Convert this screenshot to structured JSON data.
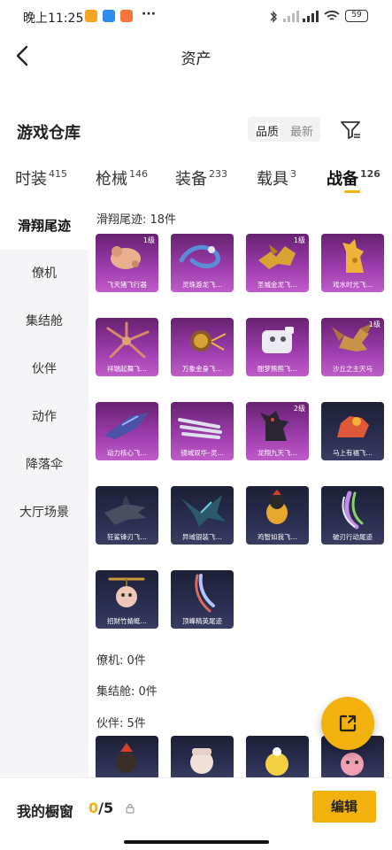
{
  "status": {
    "time": "晚上11:25",
    "battery": "59"
  },
  "header": {
    "title": "资产"
  },
  "toolbar": {
    "title": "游戏仓库",
    "sort_quality": "品质",
    "sort_latest": "最新"
  },
  "tabs": [
    {
      "label": "时装",
      "count": "415"
    },
    {
      "label": "枪械",
      "count": "146"
    },
    {
      "label": "装备",
      "count": "233"
    },
    {
      "label": "载具",
      "count": "3"
    },
    {
      "label": "战备",
      "count": "126"
    }
  ],
  "sidebar": {
    "items": [
      "滑翔尾迹",
      "僚机",
      "集结舱",
      "伙伴",
      "动作",
      "降落伞",
      "大厅场景"
    ]
  },
  "sections": {
    "glide": "滑翔尾迹: 18件",
    "wingman": "僚机: 0件",
    "pod": "集结舱: 0件",
    "partner": "伙伴: 5件"
  },
  "items": [
    {
      "name": "飞天猪飞行器",
      "level": "1级",
      "theme": "purple"
    },
    {
      "name": "灵珠游龙飞…",
      "level": "",
      "theme": "purple"
    },
    {
      "name": "圣城金龙飞…",
      "level": "1级",
      "theme": "purple"
    },
    {
      "name": "戏水时光飞…",
      "level": "",
      "theme": "purple"
    },
    {
      "name": "祥瑞起舞飞…",
      "level": "",
      "theme": "purple"
    },
    {
      "name": "万象金身飞…",
      "level": "",
      "theme": "purple"
    },
    {
      "name": "酣梦熊熊飞…",
      "level": "",
      "theme": "purple"
    },
    {
      "name": "沙丘之主天马",
      "level": "1级",
      "theme": "purple"
    },
    {
      "name": "动力核心飞…",
      "level": "",
      "theme": "purple"
    },
    {
      "name": "镜域双华–灵…",
      "level": "",
      "theme": "purple"
    },
    {
      "name": "龙翔九天飞…",
      "level": "2级",
      "theme": "purple"
    },
    {
      "name": "马上有福飞…",
      "level": "",
      "theme": "navy"
    },
    {
      "name": "狂鲨锋刃飞…",
      "level": "",
      "theme": "navy"
    },
    {
      "name": "异域银装飞…",
      "level": "",
      "theme": "navy"
    },
    {
      "name": "鸡智如我飞…",
      "level": "",
      "theme": "navy"
    },
    {
      "name": "破刃行动尾迹",
      "level": "",
      "theme": "navy"
    },
    {
      "name": "招财竹蜻蜓…",
      "level": "",
      "theme": "navy"
    },
    {
      "name": "顶峰精英尾迹",
      "level": "",
      "theme": "navy"
    }
  ],
  "footer": {
    "showcase_label": "我的橱窗",
    "count_current": "0",
    "count_total": "/5",
    "edit_label": "编辑"
  },
  "colors": {
    "accent": "#f2b10c",
    "rare_purple": "#9b3bab",
    "epic_navy": "#2a2e50"
  }
}
